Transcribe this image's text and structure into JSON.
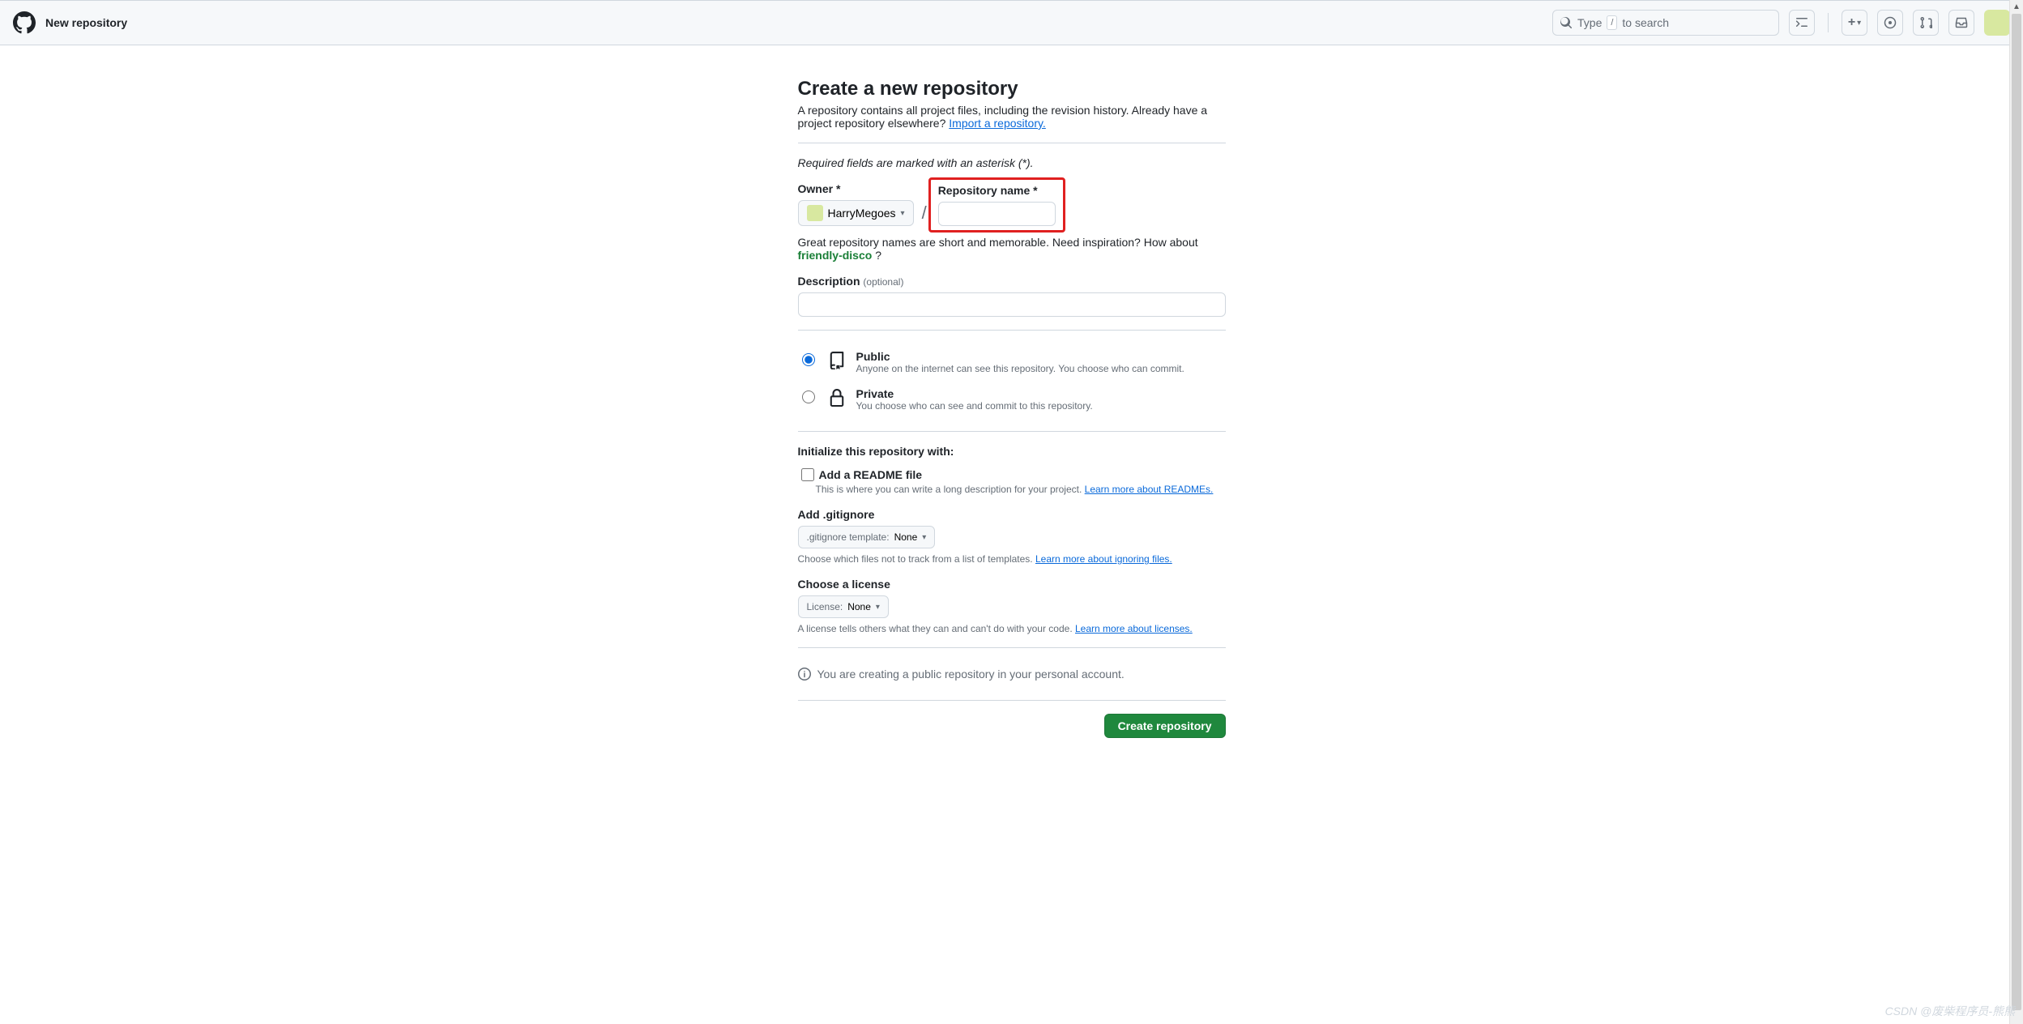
{
  "header": {
    "brand": "New repository",
    "search_prefix": "Type",
    "search_key": "/",
    "search_suffix": "to search"
  },
  "page": {
    "title": "Create a new repository",
    "subhead": "A repository contains all project files, including the revision history. Already have a project repository elsewhere?",
    "import_link": "Import a repository.",
    "required_note": "Required fields are marked with an asterisk (*).",
    "owner_label": "Owner *",
    "owner_value": "HarryMegoes",
    "repo_name_label": "Repository name *",
    "name_hint_pre": "Great repository names are short and memorable. Need inspiration? How about ",
    "name_suggestion": "friendly-disco",
    "name_hint_post": " ?",
    "description_label": "Description",
    "description_optional": "(optional)",
    "visibility": {
      "public_title": "Public",
      "public_desc": "Anyone on the internet can see this repository. You choose who can commit.",
      "private_title": "Private",
      "private_desc": "You choose who can see and commit to this repository."
    },
    "init_label": "Initialize this repository with:",
    "readme_label": "Add a README file",
    "readme_desc": "This is where you can write a long description for your project. ",
    "readme_link": "Learn more about READMEs.",
    "gitignore_label": "Add .gitignore",
    "gitignore_btn_prefix": ".gitignore template: ",
    "gitignore_value": "None",
    "gitignore_desc": "Choose which files not to track from a list of templates. ",
    "gitignore_link": "Learn more about ignoring files.",
    "license_label": "Choose a license",
    "license_btn_prefix": "License: ",
    "license_value": "None",
    "license_desc": "A license tells others what they can and can't do with your code. ",
    "license_link": "Learn more about licenses.",
    "info_text": "You are creating a public repository in your personal account.",
    "create_btn": "Create repository"
  },
  "watermark": "CSDN @废柴程序员-熊熊"
}
